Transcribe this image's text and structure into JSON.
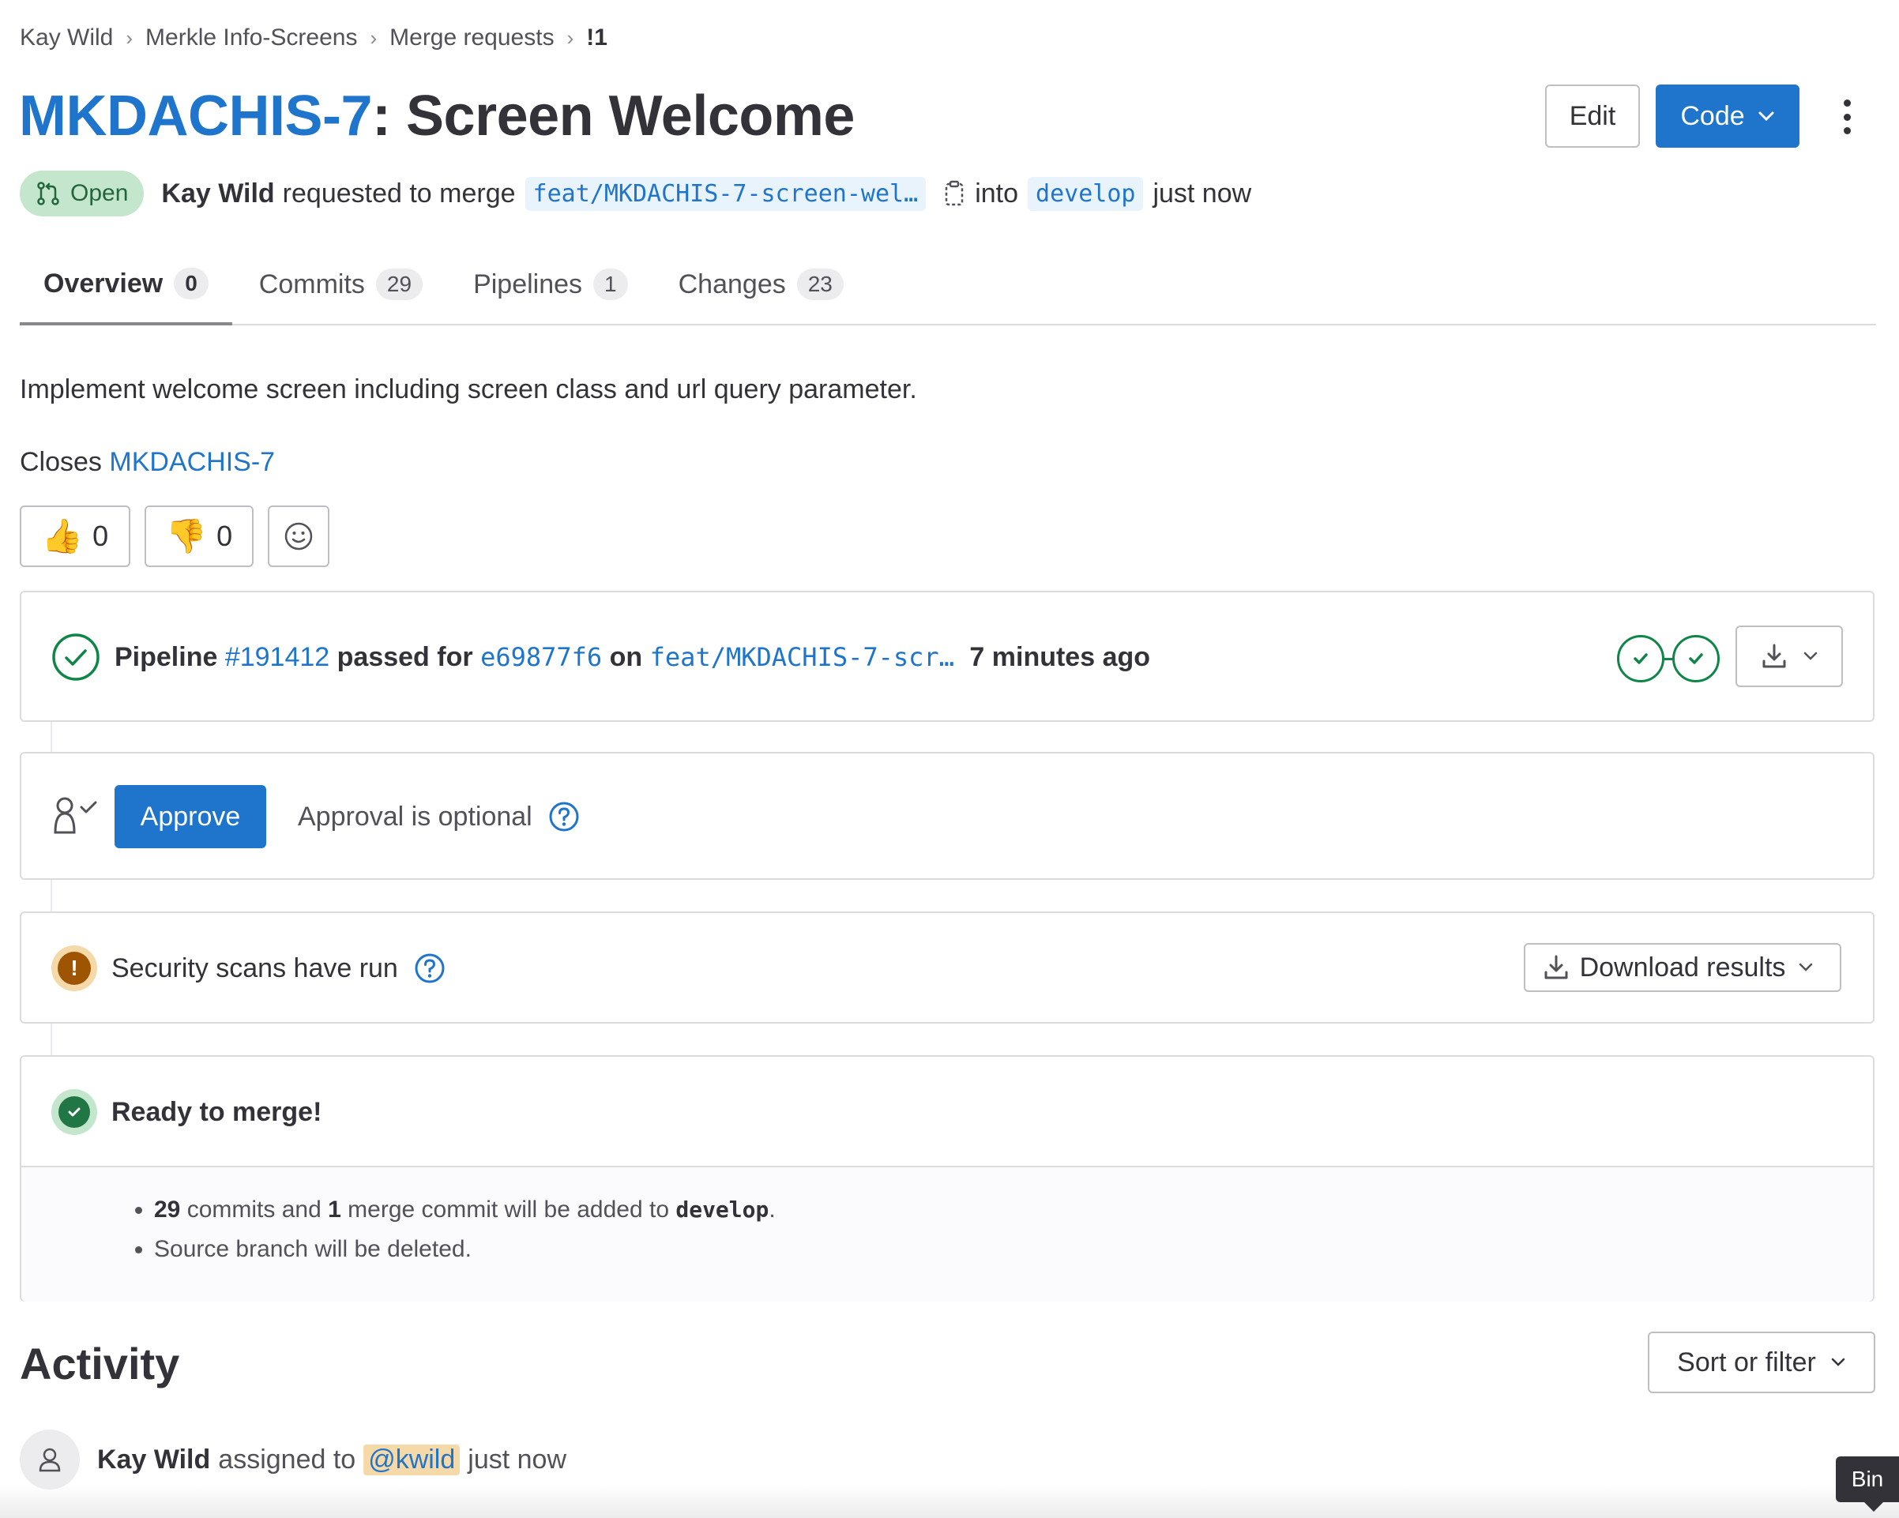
{
  "breadcrumb": {
    "items": [
      "Kay Wild",
      "Merkle Info-Screens",
      "Merge requests"
    ],
    "current": "!1"
  },
  "title": {
    "issue_key": "MKDACHIS-7",
    "rest": ": Screen Welcome"
  },
  "header_actions": {
    "edit_label": "Edit",
    "code_label": "Code"
  },
  "meta": {
    "status": "Open",
    "author": "Kay Wild",
    "action_text": "requested to merge",
    "source_branch": "feat/MKDACHIS-7-screen-wel…",
    "into_text": "into",
    "target_branch": "develop",
    "time": "just now"
  },
  "tabs": [
    {
      "label": "Overview",
      "count": "0"
    },
    {
      "label": "Commits",
      "count": "29"
    },
    {
      "label": "Pipelines",
      "count": "1"
    },
    {
      "label": "Changes",
      "count": "23"
    }
  ],
  "description": {
    "text": "Implement welcome screen including screen class and url query parameter.",
    "closes_prefix": "Closes",
    "closes_link": "MKDACHIS-7"
  },
  "reactions": {
    "thumbs_up": {
      "glyph": "👍",
      "count": "0"
    },
    "thumbs_down": {
      "glyph": "👎",
      "count": "0"
    }
  },
  "pipeline": {
    "label": "Pipeline",
    "id": "#191412",
    "status_text": "passed for",
    "commit": "e69877f6",
    "on_text": "on",
    "branch": "feat/MKDACHIS-7-scr…",
    "time": "7 minutes ago",
    "status_color": "#108548"
  },
  "approval": {
    "button_label": "Approve",
    "text": "Approval is optional"
  },
  "security": {
    "text": "Security scans have run",
    "download_label": "Download results"
  },
  "merge": {
    "title": "Ready to merge!",
    "commits_count": "29",
    "commits_text_a": "commits and",
    "merge_count": "1",
    "commits_text_b": "merge commit will be added to",
    "target": "develop",
    "period": ".",
    "deleted_text": "Source branch will be deleted."
  },
  "activity": {
    "title": "Activity",
    "sort_label": "Sort or filter",
    "items": [
      {
        "author": "Kay Wild",
        "action": "assigned to",
        "mention": "@kwild",
        "time": "just now"
      }
    ]
  },
  "tooltip": {
    "text": "Bin"
  },
  "colors": {
    "accent": "#1f75cb",
    "success": "#108548",
    "warning": "#9e5400"
  }
}
